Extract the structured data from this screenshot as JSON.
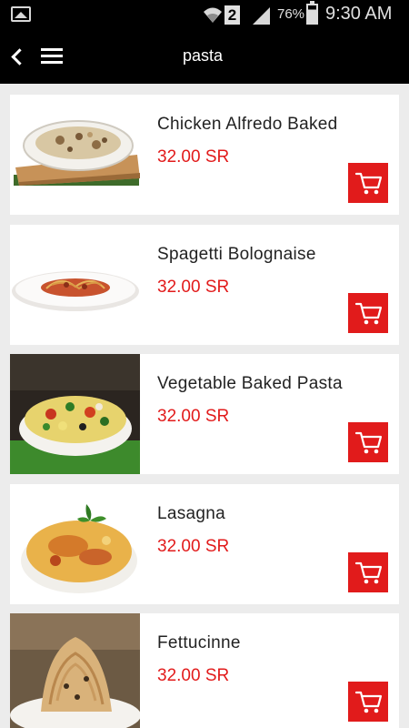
{
  "status_bar": {
    "sim_slot": "2",
    "battery": "76%",
    "battery_level": 0.76,
    "time": "9:30 AM",
    "icons": [
      "gallery-icon",
      "wifi-icon",
      "sim-icon",
      "signal-icon",
      "battery-icon"
    ]
  },
  "app_bar": {
    "title": "pasta",
    "icons": [
      "back-icon",
      "menu-icon"
    ]
  },
  "accent_color": "#e11b1b",
  "products": [
    {
      "name": "Chicken Alfredo Baked",
      "price": "32.00 SR",
      "image": "chicken-alfredo-photo"
    },
    {
      "name": "Spagetti Bolognaise",
      "price": "32.00 SR",
      "image": "spaghetti-bolognaise-photo"
    },
    {
      "name": "Vegetable Baked Pasta",
      "price": "32.00 SR",
      "image": "vegetable-baked-pasta-photo"
    },
    {
      "name": "Lasagna",
      "price": "32.00 SR",
      "image": "lasagna-photo"
    },
    {
      "name": "Fettucinne",
      "price": "32.00 SR",
      "image": "fettucinne-photo"
    }
  ]
}
